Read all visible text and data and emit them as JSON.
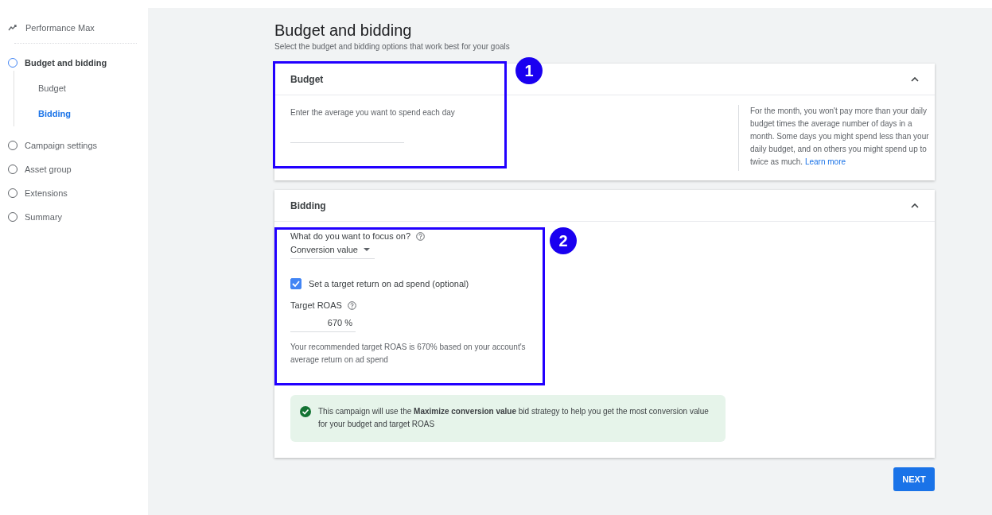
{
  "sidebar": {
    "campaign_type": "Performance Max",
    "steps": [
      {
        "label": "Budget and bidding",
        "selected": true,
        "children": [
          {
            "label": "Budget",
            "selected": false
          },
          {
            "label": "Bidding",
            "selected": true
          }
        ]
      },
      {
        "label": "Campaign settings",
        "selected": false
      },
      {
        "label": "Asset group",
        "selected": false
      },
      {
        "label": "Extensions",
        "selected": false
      },
      {
        "label": "Summary",
        "selected": false
      }
    ]
  },
  "page": {
    "title": "Budget and bidding",
    "subtitle": "Select the budget and bidding options that work best for your goals"
  },
  "budget_card": {
    "title": "Budget",
    "expanded": true,
    "field_label": "Enter the average you want to spend each day",
    "info": "For the month, you won't pay more than your daily budget times the average number of days in a month. Some days you might spend less than your daily budget, and on others you might spend up to twice as much.",
    "info_link": "Learn more",
    "annotation": "1"
  },
  "bidding_card": {
    "title": "Bidding",
    "expanded": true,
    "focus_label": "What do you want to focus on?",
    "focus_value": "Conversion value",
    "target_checkbox": {
      "label": "Set a target return on ad spend (optional)",
      "checked": true
    },
    "roas_label": "Target ROAS",
    "roas_value": "670 %",
    "roas_hint": "Your recommended target ROAS is 670% based on your account's average return on ad spend",
    "notice": "This campaign will use the **Maximize conversion value** bid strategy to help you get the most conversion value for your budget and target ROAS",
    "annotation": "2"
  },
  "next_button": "NEXT"
}
